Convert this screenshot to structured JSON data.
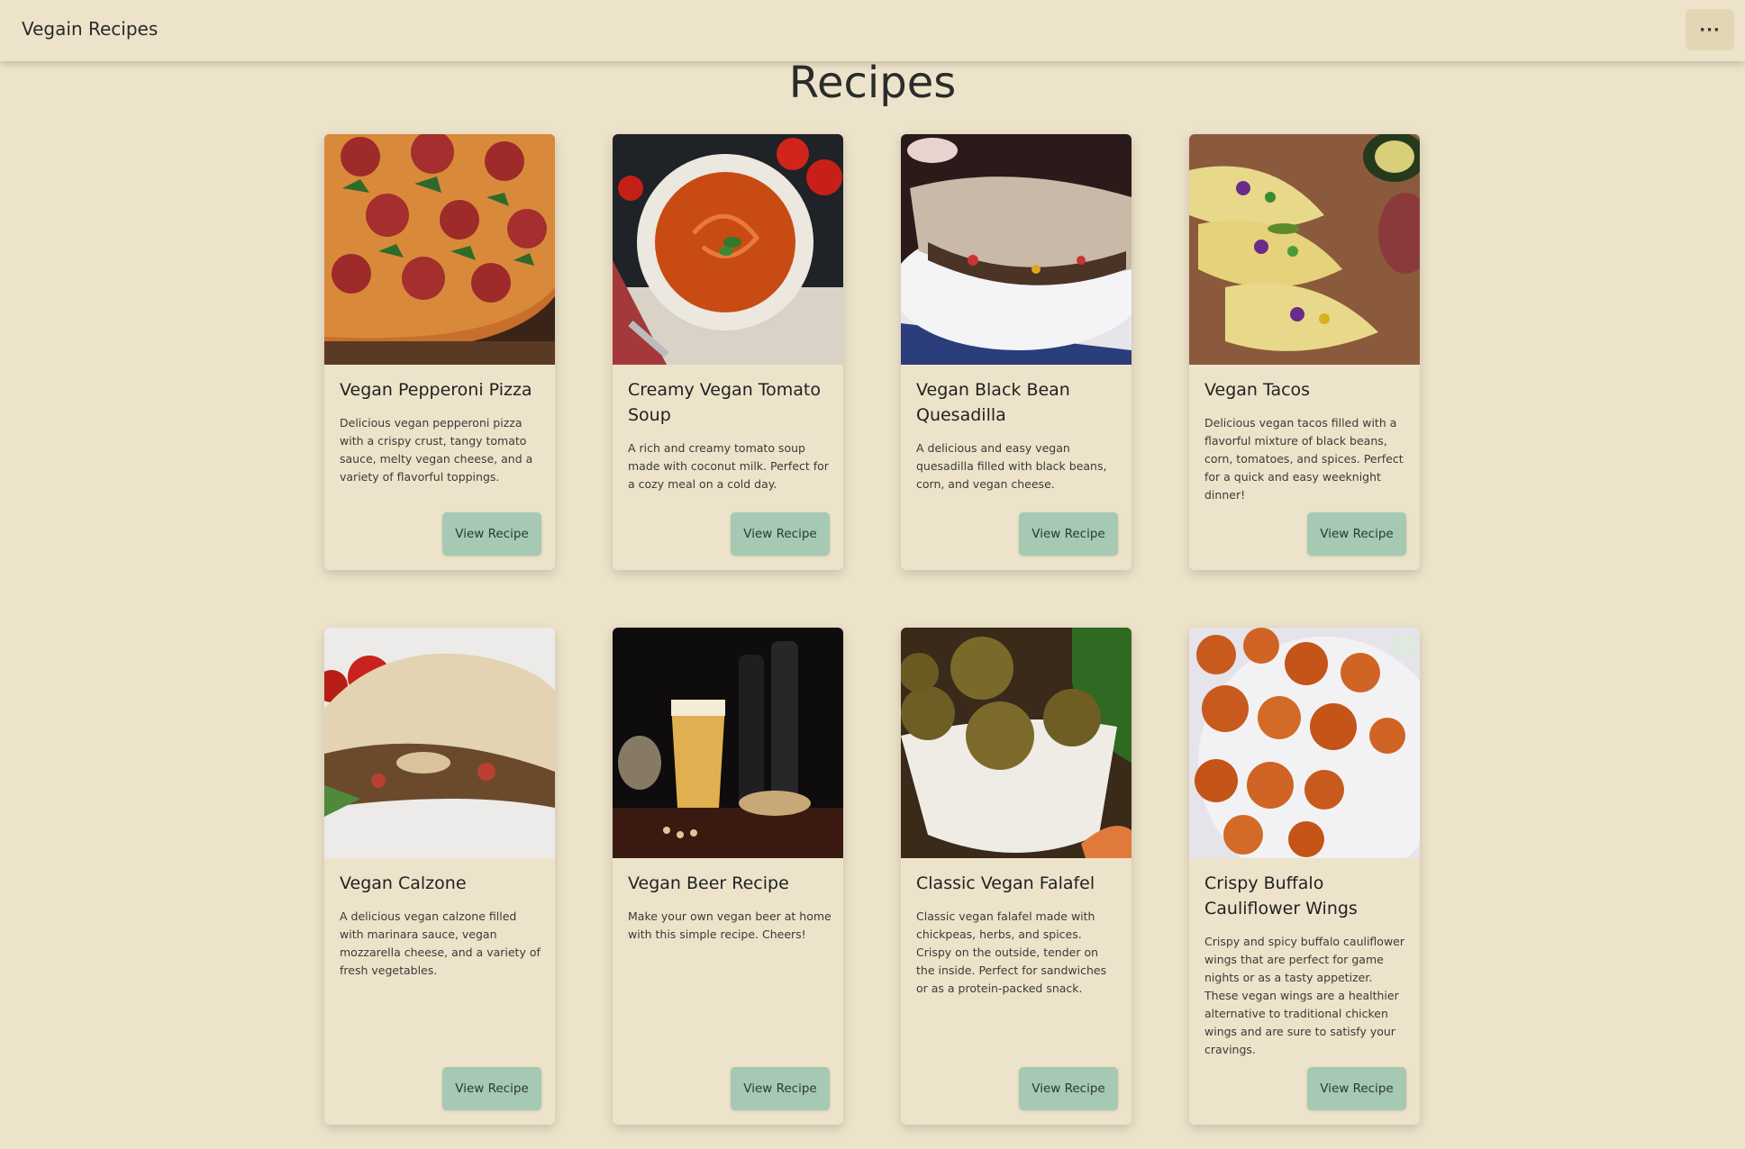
{
  "header": {
    "brand": "Vegain Recipes",
    "menu_icon": "more-dots-icon",
    "menu_glyph": "···"
  },
  "page": {
    "title": "Recipes"
  },
  "recipes": [
    {
      "title": "Vegan Pepperoni Pizza",
      "description": "Delicious vegan pepperoni pizza with a crispy crust, tangy tomato sauce, melty vegan cheese, and a variety of flavorful toppings.",
      "button": "View Recipe",
      "image": "pizza-photo"
    },
    {
      "title": "Creamy Vegan Tomato Soup",
      "description": "A rich and creamy tomato soup made with coconut milk. Perfect for a cozy meal on a cold day.",
      "button": "View Recipe",
      "image": "tomato-soup-photo"
    },
    {
      "title": "Vegan Black Bean Quesadilla",
      "description": "A delicious and easy vegan quesadilla filled with black beans, corn, and vegan cheese.",
      "button": "View Recipe",
      "image": "quesadilla-photo"
    },
    {
      "title": "Vegan Tacos",
      "description": "Delicious vegan tacos filled with a flavorful mixture of black beans, corn, tomatoes, and spices. Perfect for a quick and easy weeknight dinner!",
      "button": "View Recipe",
      "image": "tacos-photo"
    },
    {
      "title": "Vegan Calzone",
      "description": "A delicious vegan calzone filled with marinara sauce, vegan mozzarella cheese, and a variety of fresh vegetables.",
      "button": "View Recipe",
      "image": "calzone-photo"
    },
    {
      "title": "Vegan Beer Recipe",
      "description": "Make your own vegan beer at home with this simple recipe. Cheers!",
      "button": "View Recipe",
      "image": "beer-photo"
    },
    {
      "title": "Classic Vegan Falafel",
      "description": "Classic vegan falafel made with chickpeas, herbs, and spices. Crispy on the outside, tender on the inside. Perfect for sandwiches or as a protein-packed snack.",
      "button": "View Recipe",
      "image": "falafel-photo"
    },
    {
      "title": "Crispy Buffalo Cauliflower Wings",
      "description": "Crispy and spicy buffalo cauliflower wings that are perfect for game nights or as a tasty appetizer. These vegan wings are a healthier alternative to traditional chicken wings and are sure to satisfy your cravings.",
      "button": "View Recipe",
      "image": "cauliflower-wings-photo"
    }
  ],
  "colors": {
    "background": "#ede3ca",
    "button": "#a5c9b2",
    "menu_button": "#e2d6b5"
  }
}
